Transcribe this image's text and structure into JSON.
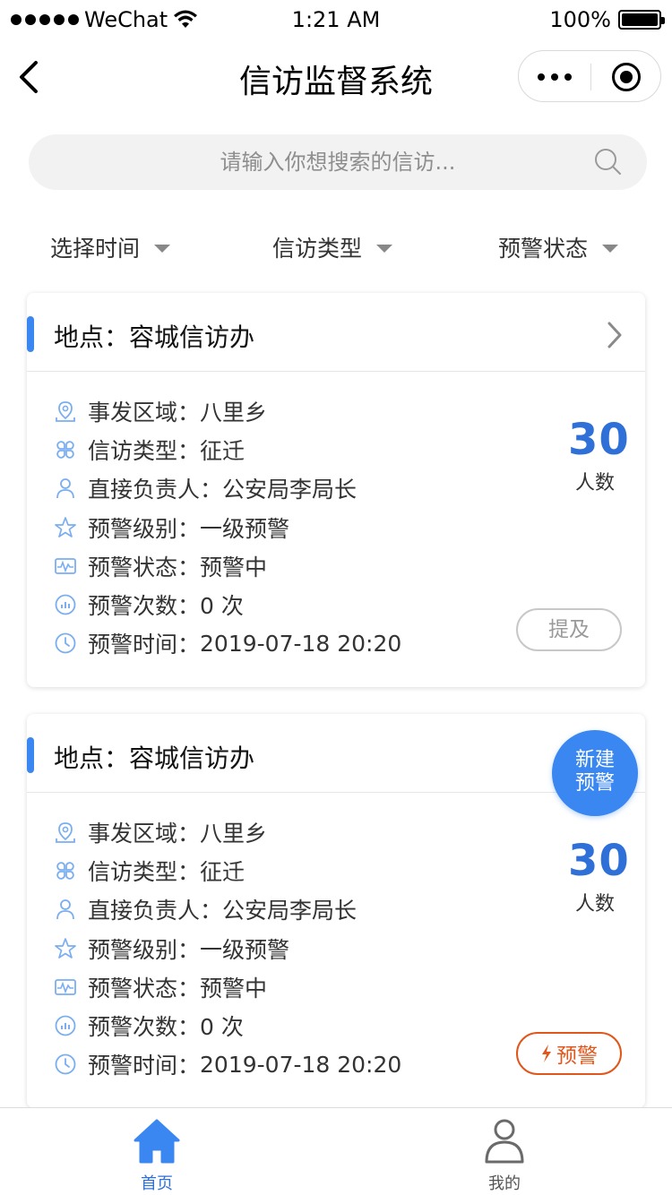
{
  "status_bar": {
    "carrier": "WeChat",
    "time": "1:21 AM",
    "battery": "100%"
  },
  "nav": {
    "title": "信访监督系统"
  },
  "search": {
    "placeholder": "请输入你想搜索的信访..."
  },
  "filters": {
    "time": "选择时间",
    "type": "信访类型",
    "status": "预警状态"
  },
  "cards": [
    {
      "location": "地点：容城信访办",
      "rows": [
        {
          "label": "事发区域：",
          "value": "八里乡"
        },
        {
          "label": "信访类型：",
          "value": "征迁"
        },
        {
          "label": "直接负责人：",
          "value": "公安局李局长"
        },
        {
          "label": "预警级别：",
          "value": "一级预警"
        },
        {
          "label": "预警状态：",
          "value": "预警中"
        },
        {
          "label": "预警次数：",
          "value": "0 次"
        },
        {
          "label": "预警时间：",
          "value": "2019-07-18  20:20"
        }
      ],
      "count": "30",
      "count_label": "人数",
      "action": "提及"
    },
    {
      "location": "地点：容城信访办",
      "rows": [
        {
          "label": "事发区域：",
          "value": "八里乡"
        },
        {
          "label": "信访类型：",
          "value": "征迁"
        },
        {
          "label": "直接负责人：",
          "value": "公安局李局长"
        },
        {
          "label": "预警级别：",
          "value": "一级预警"
        },
        {
          "label": "预警状态：",
          "value": "预警中"
        },
        {
          "label": "预警次数：",
          "value": "0 次"
        },
        {
          "label": "预警时间：",
          "value": "2019-07-18  20:20"
        }
      ],
      "count": "30",
      "count_label": "人数",
      "action": "预警"
    }
  ],
  "fab": {
    "line1": "新建",
    "line2": "预警"
  },
  "tabs": [
    {
      "label": "首页",
      "icon": "home-icon",
      "active": true
    },
    {
      "label": "我的",
      "icon": "user-icon",
      "active": false
    }
  ],
  "colors": {
    "primary": "#3a87f2",
    "count": "#2f6fd8",
    "warning": "#e0561b",
    "icon_blue": "#7aaef0"
  }
}
